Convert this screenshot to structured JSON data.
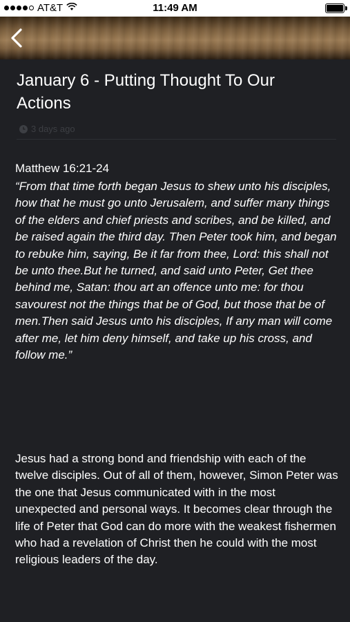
{
  "status_bar": {
    "carrier": "AT&T",
    "time": "11:49 AM"
  },
  "nav": {
    "back_icon": "chevron-left-icon"
  },
  "post": {
    "title": "January 6 - Putting Thought To Our Actions",
    "timestamp": "3 days ago",
    "reference": "Matthew 16:21-24",
    "scripture": "“From that time forth began Jesus to shew unto his disciples, how that he must go unto Jerusalem, and suffer many things of the elders and chief priests and scribes, and be killed, and be raised again the third day.  Then Peter took him, and began to rebuke him, saying, Be it far from thee, Lord: this shall not be unto thee.But he turned, and said unto Peter, Get thee behind me, Satan: thou art an offence unto me: for thou savourest not the things that be of God, but those that be of men.Then said Jesus unto his disciples, If any man will come after me, let him deny himself, and take up his cross, and follow me.”",
    "commentary": "Jesus had a strong bond and friendship with each of the twelve disciples. Out of all of them, however, Simon Peter was the one that Jesus communicated with in the most unexpected and personal ways. It becomes clear through the life of Peter that God can do more with the weakest fishermen who had a revelation of Christ then he could with the most religious leaders of the day."
  },
  "colors": {
    "background": "#1f2024",
    "text": "#ffffff",
    "meta_text": "#3d3f44"
  }
}
